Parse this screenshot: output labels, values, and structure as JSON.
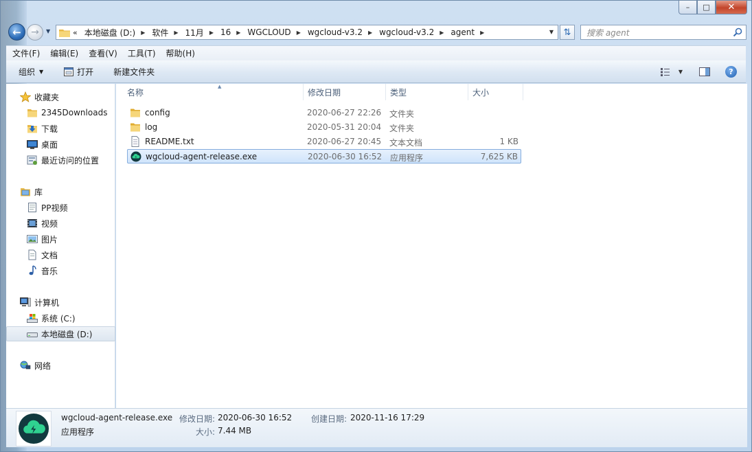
{
  "window": {
    "minimize_glyph": "–",
    "maximize_glyph": "□",
    "close_glyph": "✕"
  },
  "address": {
    "lead": "«",
    "crumbs": [
      "本地磁盘 (D:)",
      "软件",
      "11月",
      "16",
      "WGCLOUD",
      "wgcloud-v3.2",
      "wgcloud-v3.2",
      "agent"
    ],
    "search_placeholder": "搜索 agent"
  },
  "menubar": [
    "文件(F)",
    "编辑(E)",
    "查看(V)",
    "工具(T)",
    "帮助(H)"
  ],
  "commands": {
    "organize": "组织",
    "open": "打开",
    "new_folder": "新建文件夹"
  },
  "navpane": {
    "favorites": {
      "label": "收藏夹",
      "items": [
        "2345Downloads",
        "下载",
        "桌面",
        "最近访问的位置"
      ]
    },
    "libraries": {
      "label": "库",
      "items": [
        "PP视频",
        "视频",
        "图片",
        "文档",
        "音乐"
      ]
    },
    "computer": {
      "label": "计算机",
      "items": [
        "系统 (C:)",
        "本地磁盘 (D:)"
      ]
    },
    "network": {
      "label": "网络"
    }
  },
  "columns": {
    "name": "名称",
    "modified": "修改日期",
    "type": "类型",
    "size": "大小"
  },
  "files": [
    {
      "name": "config",
      "modified": "2020-06-27 22:26",
      "type": "文件夹",
      "size": ""
    },
    {
      "name": "log",
      "modified": "2020-05-31 20:04",
      "type": "文件夹",
      "size": ""
    },
    {
      "name": "README.txt",
      "modified": "2020-06-27 20:45",
      "type": "文本文档",
      "size": "1 KB"
    },
    {
      "name": "wgcloud-agent-release.exe",
      "modified": "2020-06-30 16:52",
      "type": "应用程序",
      "size": "7,625 KB"
    }
  ],
  "details": {
    "name": "wgcloud-agent-release.exe",
    "type": "应用程序",
    "modified_label": "修改日期:",
    "modified": "2020-06-30 16:52",
    "created_label": "创建日期:",
    "created": "2020-11-16 17:29",
    "size_label": "大小:",
    "size": "7.44 MB"
  },
  "colors": {
    "selection_border": "#84acdd",
    "selection_fill": "#cfe4fb",
    "app_icon_bg": "#123a3f",
    "app_icon_cloud": "#2fd190"
  }
}
